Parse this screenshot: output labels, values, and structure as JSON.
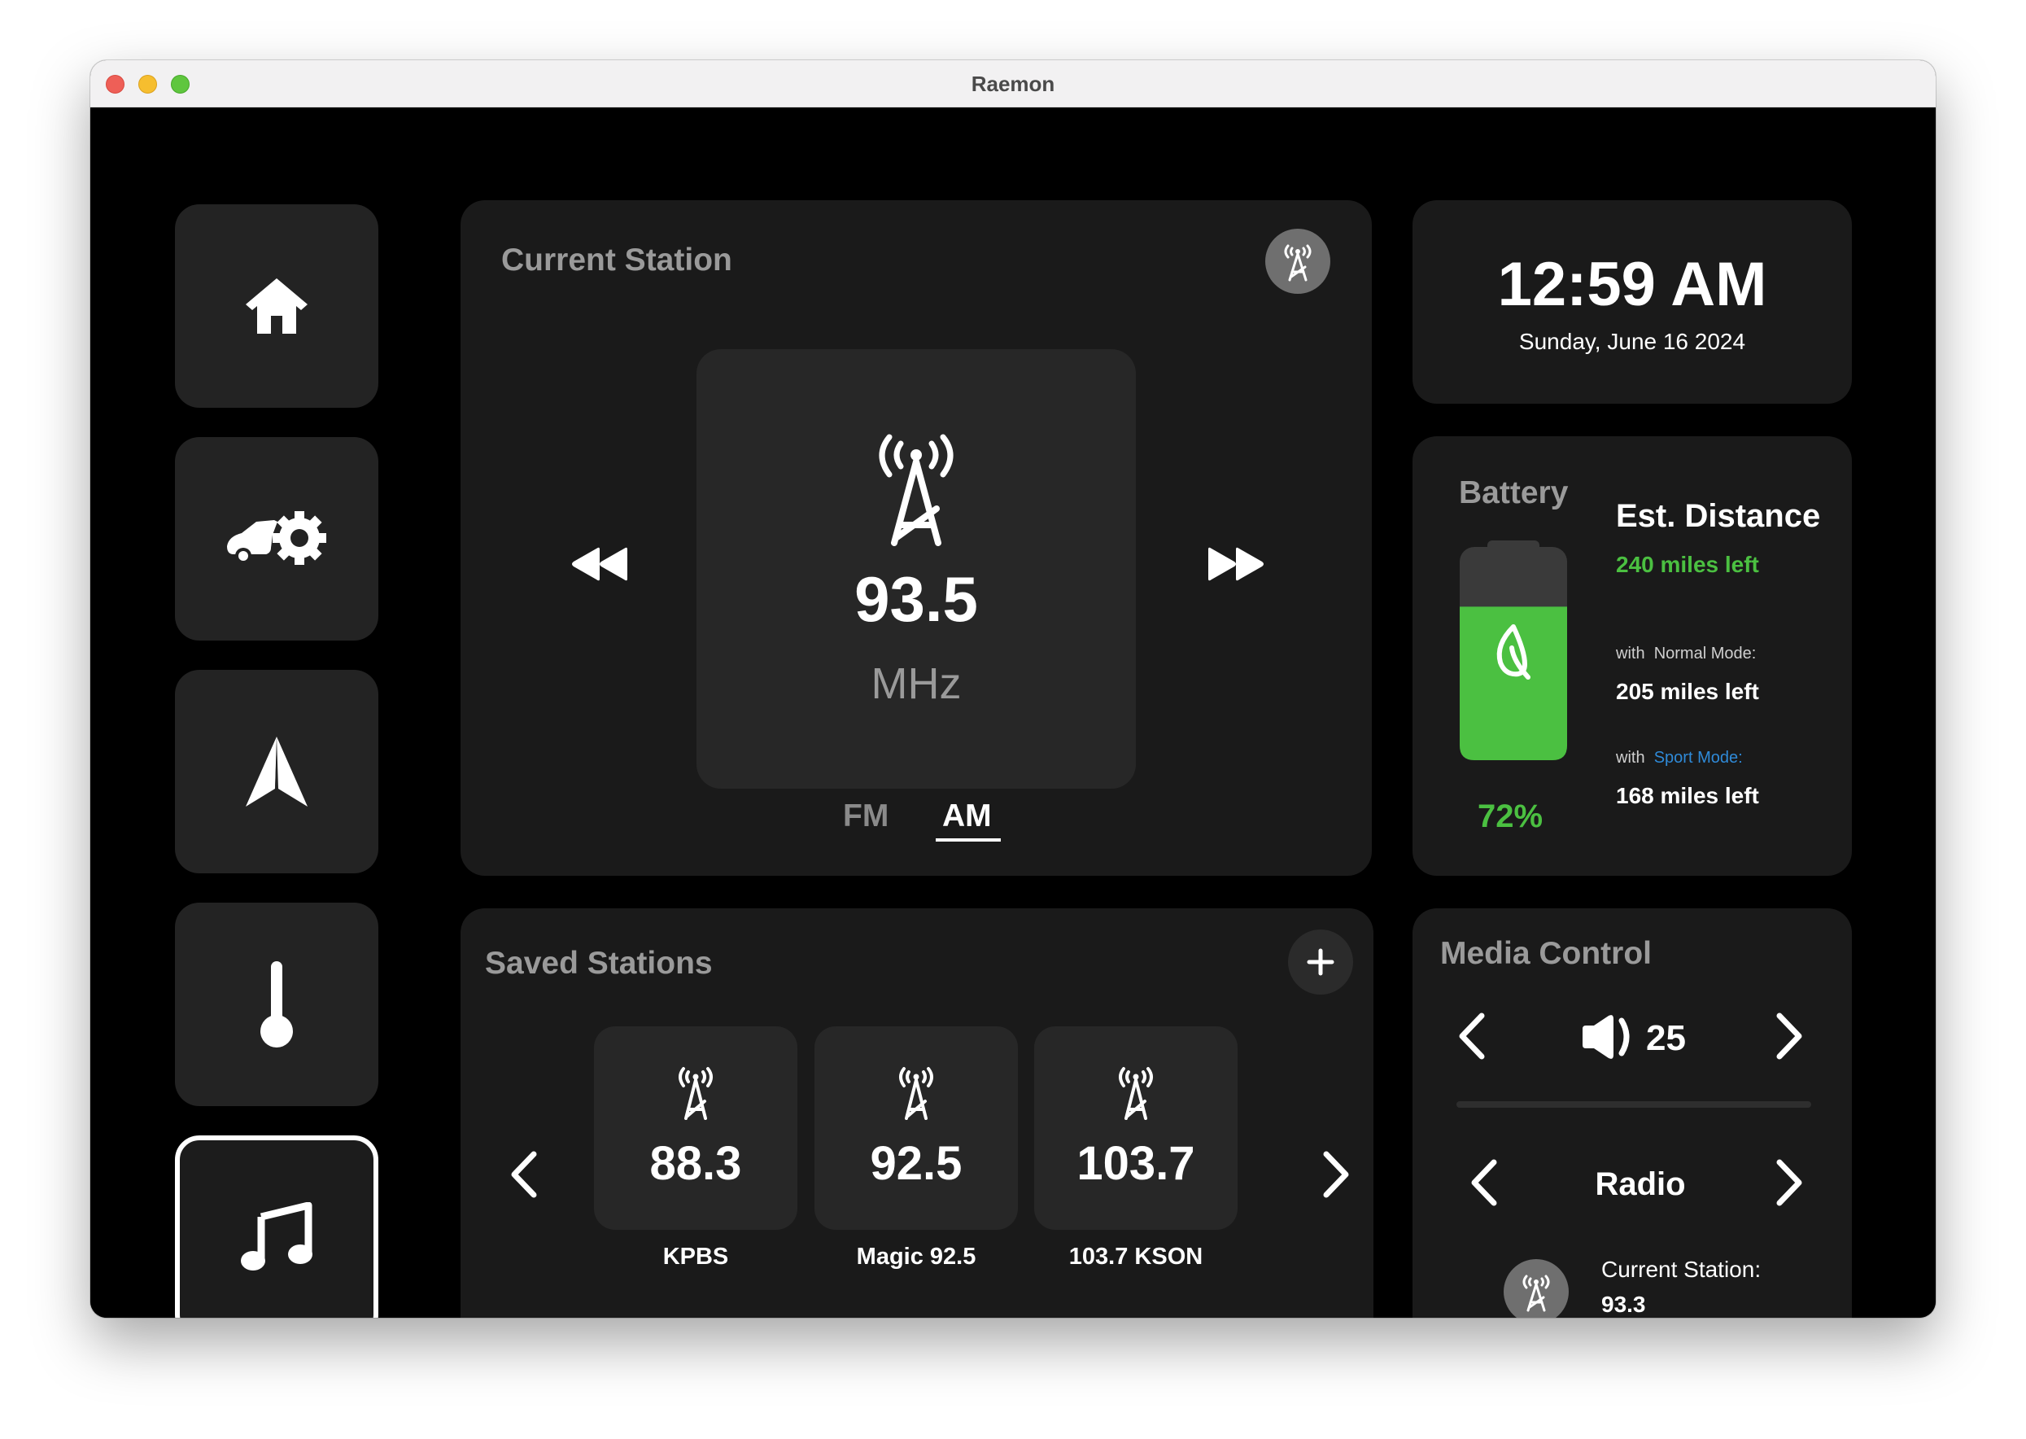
{
  "window": {
    "title": "Raemon"
  },
  "nav": {
    "items": [
      {
        "id": "home",
        "icon": "home-icon",
        "active": false
      },
      {
        "id": "car-settings",
        "icon": "car-gear-icon",
        "active": false
      },
      {
        "id": "navigation",
        "icon": "navigation-arrow-icon",
        "active": false
      },
      {
        "id": "climate",
        "icon": "thermometer-icon",
        "active": false
      },
      {
        "id": "music",
        "icon": "music-note-icon",
        "active": true
      }
    ]
  },
  "current_station": {
    "title": "Current Station",
    "frequency": "93.5",
    "unit": "MHz",
    "bands": [
      "FM",
      "AM"
    ],
    "selected_band": "AM",
    "icons": {
      "radio": "radio-tower-icon",
      "prev": "rewind-icon",
      "next": "fast-forward-icon"
    }
  },
  "saved_stations": {
    "title": "Saved Stations",
    "stations": [
      {
        "frequency": "88.3",
        "name": "KPBS"
      },
      {
        "frequency": "92.5",
        "name": "Magic 92.5"
      },
      {
        "frequency": "103.7",
        "name": "103.7 KSON"
      }
    ]
  },
  "clock": {
    "time": "12:59 AM",
    "date": "Sunday, June 16 2024"
  },
  "battery": {
    "title": "Battery",
    "percent": 72,
    "percent_label": "72%",
    "est_title": "Est. Distance",
    "est_miles": "240 miles left",
    "normal_prefix": "with",
    "normal_mode": "Normal Mode:",
    "normal_miles": "205 miles left",
    "sport_prefix": "with",
    "sport_mode": "Sport Mode:",
    "sport_miles": "168 miles left",
    "colors": {
      "green": "#4bc041",
      "sport": "#2f8ad8"
    }
  },
  "media_control": {
    "title": "Media Control",
    "volume": "25",
    "source": "Radio",
    "current_label": "Current Station:",
    "current_value": "93.3"
  }
}
